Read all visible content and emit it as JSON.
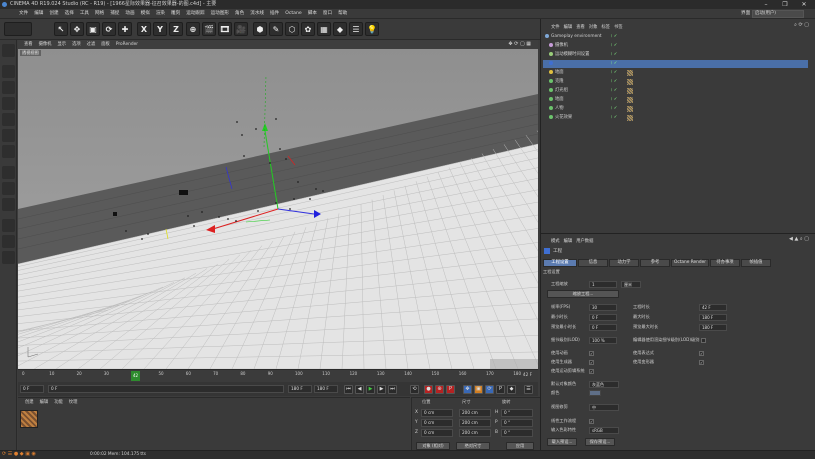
{
  "window": {
    "title": "CINEMA 4D R19.024 Studio (RC - R19) - [1966星际效果器-征召效果器-的图.c4d] - 主要",
    "controls": [
      "–",
      "❐",
      "✕"
    ]
  },
  "menubar": {
    "items": [
      "文件",
      "编辑",
      "创建",
      "选择",
      "工具",
      "网格",
      "捕捉",
      "动画",
      "模拟",
      "渲染",
      "雕刻",
      "运动跟踪",
      "运动图形",
      "角色",
      "流水线",
      "插件",
      "Octane",
      "脚本",
      "窗口",
      "帮助"
    ],
    "layout_label": "界面",
    "layout_value": "启动(用户)"
  },
  "toolbar": {
    "buttons": [
      "↶",
      "↷",
      "↖",
      "✥",
      "▣",
      "⟳",
      "✚",
      "X",
      "Y",
      "Z",
      "⊕",
      "🎬",
      "🎞",
      "🎥",
      "⬢",
      "✎",
      "⬡",
      "✿",
      "▦",
      "◆",
      "☰",
      "💡"
    ]
  },
  "viewport": {
    "menu": [
      "查看",
      "摄像机",
      "显示",
      "选项",
      "过滤",
      "面板",
      "ProRender"
    ],
    "label": "透视视图"
  },
  "timeline": {
    "ticks": [
      "0",
      "10",
      "20",
      "30",
      "40",
      "50",
      "60",
      "70",
      "80",
      "90",
      "100",
      "110",
      "120",
      "130",
      "140",
      "150",
      "160",
      "170",
      "180"
    ],
    "current_frame": "42",
    "end_label": "42 F"
  },
  "playback": {
    "start": "0 F",
    "current": "0 F",
    "end": "180 F",
    "end2": "180 F"
  },
  "material_panel": {
    "menu": [
      "创建",
      "编辑",
      "功能",
      "纹理"
    ]
  },
  "coords": {
    "headers": [
      "位置",
      "尺寸",
      "旋转"
    ],
    "rows": [
      {
        "axis": "X",
        "pos": "0 cm",
        "size": "200 cm",
        "rot_label": "H",
        "rot": "0 °"
      },
      {
        "axis": "Y",
        "pos": "0 cm",
        "size": "200 cm",
        "rot_label": "P",
        "rot": "0 °"
      },
      {
        "axis": "Z",
        "pos": "0 cm",
        "size": "200 cm",
        "rot_label": "B",
        "rot": "0 °"
      }
    ],
    "mode": "对象 (相对)",
    "size_mode": "绝对尺寸",
    "apply": "应用"
  },
  "status": {
    "text": "0:00:02  Mem: 104.175 tts"
  },
  "object_manager": {
    "menu": [
      "文件",
      "编辑",
      "查看",
      "对象",
      "标签",
      "书签"
    ],
    "objects": [
      {
        "name": "Gameplay environment",
        "color": "#7fa8d8"
      },
      {
        "name": "摄像机",
        "color": "#c69bd8"
      },
      {
        "name": "运动模糊时间设置",
        "color": "#9acd7a"
      },
      {
        "name": "",
        "color": "#3f6fd2"
      },
      {
        "name": "地面",
        "color": "#e0c040"
      },
      {
        "name": "克隆",
        "color": "#6cc36c"
      },
      {
        "name": "灯光组",
        "color": "#6cc36c"
      },
      {
        "name": "地面",
        "color": "#6cc36c"
      },
      {
        "name": "人物",
        "color": "#6cc36c"
      },
      {
        "name": "火花效果",
        "color": "#6cc36c"
      }
    ]
  },
  "attributes": {
    "menu": [
      "模式",
      "编辑",
      "用户数据"
    ],
    "title": "工程",
    "tabs": [
      "工程设置",
      "信息",
      "动力学",
      "参考",
      "Octane Render",
      "待办事项",
      "帧插值"
    ],
    "section": "工程设置",
    "scale_label": "工程缩放",
    "scale_value": "1",
    "scale_unit": "厘米",
    "scale_button": "缩放工程...",
    "fps_label": "帧率(FPS)",
    "fps_value": "30",
    "proj_time_label": "工程时长",
    "proj_time_value": "42 F",
    "min_time_label": "最小时长",
    "min_time_value": "0 F",
    "max_time_label": "最大时长",
    "max_time_value": "180 F",
    "preview_min_label": "预览最小时长",
    "preview_min_value": "0 F",
    "preview_max_label": "预览最大时长",
    "preview_max_value": "180 F",
    "lod_label": "细节级别(LOD)",
    "lod_value": "100 %",
    "lod_render_label": "编辑器使用渲染细节级别(LOD)级别",
    "checks": [
      {
        "label": "使用动画",
        "checked": "✓"
      },
      {
        "label": "使用表达式",
        "checked": "✓"
      },
      {
        "label": "使用生成器",
        "checked": "✓"
      },
      {
        "label": "使用变形器",
        "checked": "✓"
      },
      {
        "label": "使用运动剪辑系统",
        "checked": "✓"
      }
    ],
    "default_color_label": "默认对象颜色",
    "default_color_value": "灰蓝色",
    "color_label": "颜色",
    "view_clip_label": "视图修剪",
    "view_clip_value": "中",
    "linear_label": "线性工作流程",
    "input_color_label": "输入色彩特性",
    "input_color_value": "sRGB",
    "load_preset": "载入预设...",
    "save_preset": "保存预设..."
  }
}
